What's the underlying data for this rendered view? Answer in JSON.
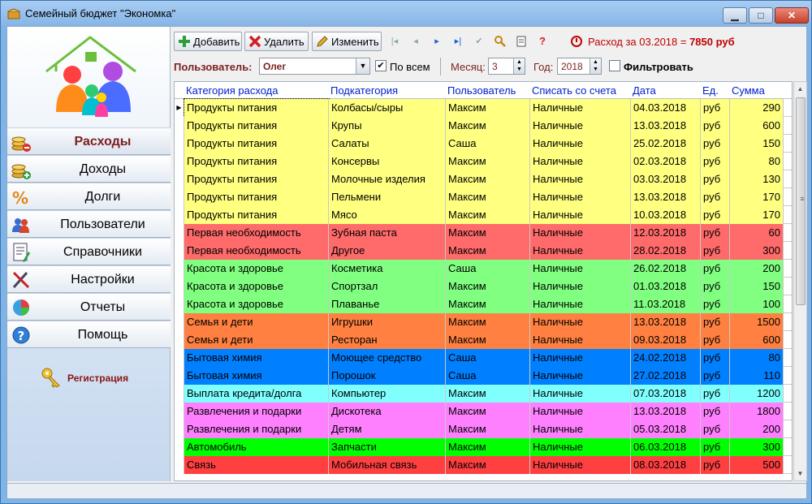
{
  "window": {
    "title": "Семейный бюджет \"Экономка\""
  },
  "sidebar": {
    "items": [
      {
        "label": "Расходы",
        "icon": "coins-minus-icon"
      },
      {
        "label": "Доходы",
        "icon": "coins-plus-icon"
      },
      {
        "label": "Долги",
        "icon": "percent-icon"
      },
      {
        "label": "Пользователи",
        "icon": "users-icon"
      },
      {
        "label": "Справочники",
        "icon": "notebook-icon"
      },
      {
        "label": "Настройки",
        "icon": "tools-icon"
      },
      {
        "label": "Отчеты",
        "icon": "pie-chart-icon"
      },
      {
        "label": "Помощь",
        "icon": "help-icon"
      }
    ],
    "registration_label": "Регистрация"
  },
  "toolbar": {
    "add_label": "Добавить",
    "delete_label": "Удалить",
    "edit_label": "Изменить",
    "expense_prefix": "Расход за 03.2018 = ",
    "expense_amount": "7850 руб"
  },
  "filters": {
    "user_label": "Пользователь:",
    "user_value": "Олег",
    "all_label": "По всем",
    "all_checked": true,
    "month_label": "Месяц:",
    "month_value": "3",
    "year_label": "Год:",
    "year_value": "2018",
    "filter_label": "Фильтровать",
    "filter_checked": false
  },
  "grid": {
    "columns": [
      "Категория расхода",
      "Подкатегория",
      "Пользователь",
      "Списать со счета",
      "Дата",
      "Ед.",
      "Сумма"
    ],
    "rows": [
      {
        "category": "Продукты питания",
        "subcategory": "Колбасы/сыры",
        "user": "Максим",
        "account": "Наличные",
        "date": "04.03.2018",
        "unit": "руб",
        "sum": "290",
        "color": "#ffff80"
      },
      {
        "category": "Продукты питания",
        "subcategory": "Крупы",
        "user": "Максим",
        "account": "Наличные",
        "date": "13.03.2018",
        "unit": "руб",
        "sum": "600",
        "color": "#ffff80"
      },
      {
        "category": "Продукты питания",
        "subcategory": "Салаты",
        "user": "Саша",
        "account": "Наличные",
        "date": "25.02.2018",
        "unit": "руб",
        "sum": "150",
        "color": "#ffff80"
      },
      {
        "category": "Продукты питания",
        "subcategory": "Консервы",
        "user": "Максим",
        "account": "Наличные",
        "date": "02.03.2018",
        "unit": "руб",
        "sum": "80",
        "color": "#ffff80"
      },
      {
        "category": "Продукты питания",
        "subcategory": "Молочные изделия",
        "user": "Максим",
        "account": "Наличные",
        "date": "03.03.2018",
        "unit": "руб",
        "sum": "130",
        "color": "#ffff80"
      },
      {
        "category": "Продукты питания",
        "subcategory": "Пельмени",
        "user": "Максим",
        "account": "Наличные",
        "date": "13.03.2018",
        "unit": "руб",
        "sum": "170",
        "color": "#ffff80"
      },
      {
        "category": "Продукты питания",
        "subcategory": "Мясо",
        "user": "Максим",
        "account": "Наличные",
        "date": "10.03.2018",
        "unit": "руб",
        "sum": "170",
        "color": "#ffff80"
      },
      {
        "category": "Первая необходимость",
        "subcategory": "Зубная паста",
        "user": "Максим",
        "account": "Наличные",
        "date": "12.03.2018",
        "unit": "руб",
        "sum": "60",
        "color": "#ff6a6a"
      },
      {
        "category": "Первая необходимость",
        "subcategory": "Другое",
        "user": "Максим",
        "account": "Наличные",
        "date": "28.02.2018",
        "unit": "руб",
        "sum": "300",
        "color": "#ff6a6a"
      },
      {
        "category": "Красота и здоровье",
        "subcategory": "Косметика",
        "user": "Саша",
        "account": "Наличные",
        "date": "26.02.2018",
        "unit": "руб",
        "sum": "200",
        "color": "#80ff80"
      },
      {
        "category": "Красота и здоровье",
        "subcategory": "Спортзал",
        "user": "Максим",
        "account": "Наличные",
        "date": "01.03.2018",
        "unit": "руб",
        "sum": "150",
        "color": "#80ff80"
      },
      {
        "category": "Красота и здоровье",
        "subcategory": "Плаванье",
        "user": "Максим",
        "account": "Наличные",
        "date": "11.03.2018",
        "unit": "руб",
        "sum": "100",
        "color": "#80ff80"
      },
      {
        "category": "Семья и дети",
        "subcategory": "Игрушки",
        "user": "Максим",
        "account": "Наличные",
        "date": "13.03.2018",
        "unit": "руб",
        "sum": "1500",
        "color": "#ff8040"
      },
      {
        "category": "Семья и дети",
        "subcategory": "Ресторан",
        "user": "Максим",
        "account": "Наличные",
        "date": "09.03.2018",
        "unit": "руб",
        "sum": "600",
        "color": "#ff8040"
      },
      {
        "category": "Бытовая химия",
        "subcategory": "Моющее средство",
        "user": "Саша",
        "account": "Наличные",
        "date": "24.02.2018",
        "unit": "руб",
        "sum": "80",
        "color": "#0080ff"
      },
      {
        "category": "Бытовая химия",
        "subcategory": "Порошок",
        "user": "Саша",
        "account": "Наличные",
        "date": "27.02.2018",
        "unit": "руб",
        "sum": "110",
        "color": "#0080ff"
      },
      {
        "category": "Выплата кредита/долга",
        "subcategory": "Компьютер",
        "user": "Максим",
        "account": "Наличные",
        "date": "07.03.2018",
        "unit": "руб",
        "sum": "1200",
        "color": "#80ffff"
      },
      {
        "category": "Развлечения и подарки",
        "subcategory": "Дискотека",
        "user": "Максим",
        "account": "Наличные",
        "date": "13.03.2018",
        "unit": "руб",
        "sum": "1800",
        "color": "#ff80ff"
      },
      {
        "category": "Развлечения и подарки",
        "subcategory": "Детям",
        "user": "Максим",
        "account": "Наличные",
        "date": "05.03.2018",
        "unit": "руб",
        "sum": "200",
        "color": "#ff80ff"
      },
      {
        "category": "Автомобиль",
        "subcategory": "Запчасти",
        "user": "Максим",
        "account": "Наличные",
        "date": "06.03.2018",
        "unit": "руб",
        "sum": "300",
        "color": "#00ff00"
      },
      {
        "category": "Связь",
        "subcategory": "Мобильная связь",
        "user": "Максим",
        "account": "Наличные",
        "date": "08.03.2018",
        "unit": "руб",
        "sum": "500",
        "color": "#ff4040"
      }
    ]
  }
}
